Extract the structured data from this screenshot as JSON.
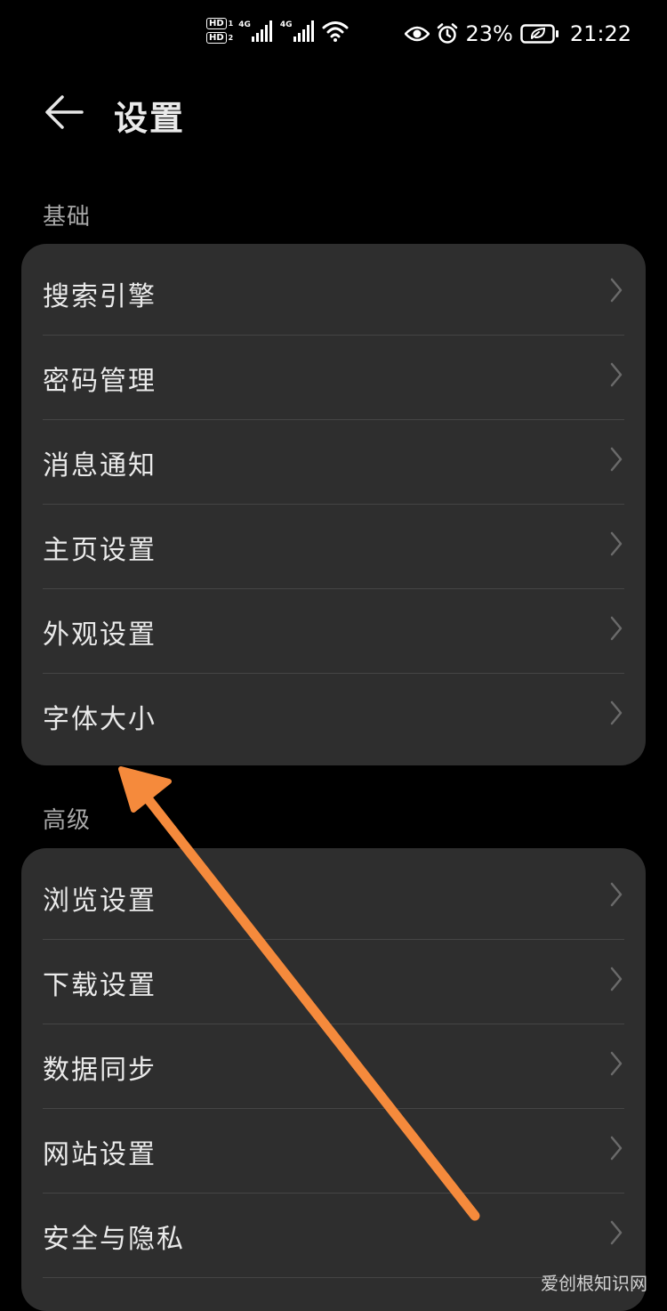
{
  "status_bar": {
    "sim1": "HD",
    "sim1_index": "1",
    "sim2": "HD",
    "sim2_index": "2",
    "network1": "4G",
    "network2": "4G",
    "icons": [
      "eye-icon",
      "alarm-icon",
      "battery-icon",
      "wifi-icon",
      "signal-icon"
    ],
    "battery_percent": "23%",
    "time": "21:22"
  },
  "header": {
    "back_icon": "back-arrow-icon",
    "title": "设置"
  },
  "sections": [
    {
      "label": "基础",
      "items": [
        {
          "label": "搜索引擎"
        },
        {
          "label": "密码管理"
        },
        {
          "label": "消息通知"
        },
        {
          "label": "主页设置"
        },
        {
          "label": "外观设置"
        },
        {
          "label": "字体大小"
        }
      ]
    },
    {
      "label": "高级",
      "items": [
        {
          "label": "浏览设置"
        },
        {
          "label": "下载设置"
        },
        {
          "label": "数据同步"
        },
        {
          "label": "网站设置"
        },
        {
          "label": "安全与隐私"
        }
      ]
    }
  ],
  "annotation": {
    "color": "#f58a3c"
  },
  "watermark": "爱创根知识网",
  "colors": {
    "background": "#000000",
    "card": "#2e2e2e",
    "divider": "#454545",
    "text": "#eaeaea",
    "section_label": "#a8a8a8",
    "chevron": "#6a6a6a"
  }
}
